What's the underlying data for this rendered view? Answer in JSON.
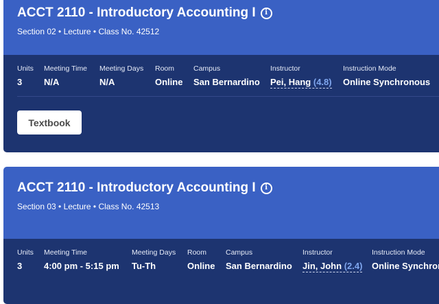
{
  "courses": [
    {
      "title": "ACCT 2110 - Introductory Accounting I",
      "info_icon": "info-circle-icon",
      "subtitle": "Section 02 • Lecture • Class No. 42512",
      "labels": {
        "units": "Units",
        "meeting_time": "Meeting Time",
        "meeting_days": "Meeting Days",
        "room": "Room",
        "campus": "Campus",
        "instructor": "Instructor",
        "instruction_mode": "Instruction Mode"
      },
      "units": "3",
      "meeting_time": "N/A",
      "meeting_days": "N/A",
      "room": "Online",
      "campus": "San Bernardino",
      "instructor_name": "Pei, Hang",
      "instructor_rating": "(4.8)",
      "instruction_mode": "Online Synchronous",
      "textbook_button": "Textbook"
    },
    {
      "title": "ACCT 2110 - Introductory Accounting I",
      "info_icon": "info-circle-icon",
      "subtitle": "Section 03 • Lecture • Class No. 42513",
      "labels": {
        "units": "Units",
        "meeting_time": "Meeting Time",
        "meeting_days": "Meeting Days",
        "room": "Room",
        "campus": "Campus",
        "instructor": "Instructor",
        "instruction_mode": "Instruction Mode"
      },
      "units": "3",
      "meeting_time": "4:00 pm - 5:15 pm",
      "meeting_days": "Tu-Th",
      "room": "Online",
      "campus": "San Bernardino",
      "instructor_name": "Jin, John",
      "instructor_rating": "(2.4)",
      "instruction_mode": "Online Synchronous"
    }
  ],
  "colors": {
    "header_blue": "#3a61c4",
    "body_navy": "#1d3470",
    "rating_blue": "#7fa6ee"
  }
}
